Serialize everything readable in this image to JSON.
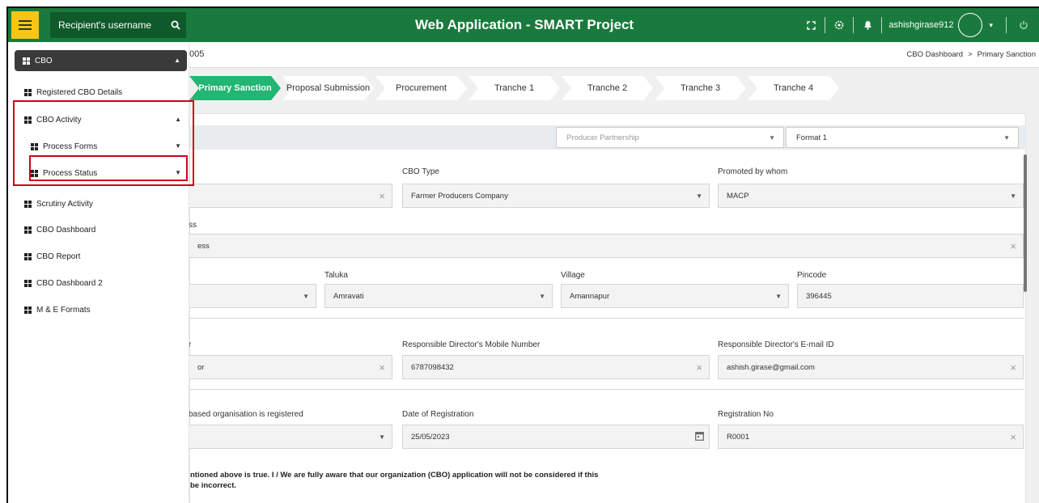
{
  "topbar": {
    "search_label": "Recipient's username",
    "title": "Web Application - SMART Project",
    "username": "ashishgirase912"
  },
  "breadcrumb": {
    "left_text": "005",
    "items": [
      "CBO Dashboard",
      ">",
      "Primary Sanction"
    ]
  },
  "steps": [
    {
      "label": "Primary Sanction",
      "active": true
    },
    {
      "label": "Proposal Submission",
      "active": false
    },
    {
      "label": "Procurement",
      "active": false
    },
    {
      "label": "Tranche 1",
      "active": false
    },
    {
      "label": "Tranche 2",
      "active": false
    },
    {
      "label": "Tranche 3",
      "active": false
    },
    {
      "label": "Tranche 4",
      "active": false
    }
  ],
  "filters": {
    "partnership": "Producer Partnership",
    "format": "Format 1"
  },
  "form": {
    "cbo_type_label": "CBO Type",
    "cbo_type_value": "Farmer Producers Company",
    "promoted_label": "Promoted by whom",
    "promoted_value": "MACP",
    "address_label": "ss",
    "address_value": "ess",
    "taluka_label": "Taluka",
    "taluka_value": "Amravati",
    "village_label": "Village",
    "village_value": "Amannapur",
    "pincode_label": "Pincode",
    "pincode_value": "396445",
    "director_label": "r",
    "director_value": "or",
    "mobile_label": "Responsible Director's Mobile Number",
    "mobile_value": "6787098432",
    "email_label": "Responsible Director's E-mail ID",
    "email_value": "ashish.girase@gmail.com",
    "reg_under_label": "based organisation is registered",
    "date_label": "Date of Registration",
    "date_value": "25/05/2023",
    "regno_label": "Registration No",
    "regno_value": "R0001",
    "declaration_line1": "ntioned above is true. I / We are fully aware that our organization (CBO) application will not be considered if this",
    "declaration_line2": "be incorrect."
  },
  "sidebar": {
    "head": "CBO",
    "items": [
      "Registered CBO Details",
      "CBO Activity",
      "Process Forms",
      "Process Status",
      "Scrutiny Activity",
      "CBO Dashboard",
      "CBO Report",
      "CBO Dashboard 2",
      "M & E Formats"
    ]
  },
  "colors": {
    "topbar": "#1a7a3d",
    "menu_button": "#f5c518",
    "active_step": "#22b573",
    "highlight": "#d0021b"
  }
}
